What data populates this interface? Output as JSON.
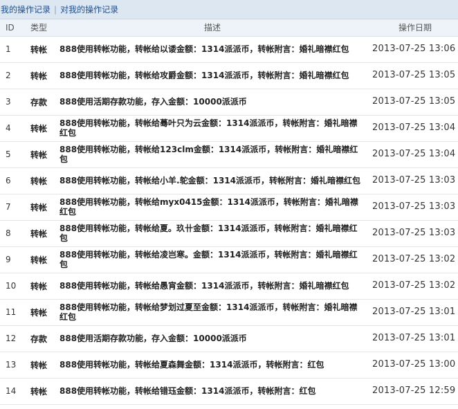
{
  "tabs": {
    "my_records": "我的操作记录",
    "separator": "|",
    "records_on_me": "对我的操作记录"
  },
  "table": {
    "headers": {
      "id": "ID",
      "type": "类型",
      "description": "描述",
      "date": "操作日期"
    },
    "rows": [
      {
        "id": "1",
        "type": "转帐",
        "description": "888使用转帐功能，转帐给以诿金额：1314派派币，转帐附言：婚礼暗襟红包",
        "date": "2013-07-25 13:06"
      },
      {
        "id": "2",
        "type": "转帐",
        "description": "888使用转帐功能，转帐给攻爵金额：1314派派币，转帐附言：婚礼暗襟红包",
        "date": "2013-07-25 13:05"
      },
      {
        "id": "3",
        "type": "存款",
        "description": "888使用活期存款功能，存入金额：10000派派币",
        "date": "2013-07-25 13:05"
      },
      {
        "id": "4",
        "type": "转帐",
        "description": "888使用转帐功能，转帐给蓦叶只为云金额：1314派派币，转帐附言：婚礼暗襟红包",
        "date": "2013-07-25 13:04"
      },
      {
        "id": "5",
        "type": "转帐",
        "description": "888使用转帐功能，转帐给123clm金额：1314派派币，转帐附言：婚礼暗襟红包",
        "date": "2013-07-25 13:04"
      },
      {
        "id": "6",
        "type": "转帐",
        "description": "888使用转帐功能，转帐给小羊.鸵金额：1314派派币，转帐附言：婚礼暗襟红包",
        "date": "2013-07-25 13:03"
      },
      {
        "id": "7",
        "type": "转帐",
        "description": "888使用转帐功能，转帐给myx0415金额：1314派派币，转帐附言：婚礼暗襟红包",
        "date": "2013-07-25 13:03"
      },
      {
        "id": "8",
        "type": "转帐",
        "description": "888使用转帐功能，转帐给夏。玖卄金额：1314派派币，转帐附言：婚礼暗襟红包",
        "date": "2013-07-25 13:03"
      },
      {
        "id": "9",
        "type": "转帐",
        "description": "888使用转帐功能，转帐给凌岂寒。金额：1314派派币，转帐附言：婚礼暗襟红包",
        "date": "2013-07-25 13:02"
      },
      {
        "id": "10",
        "type": "转帐",
        "description": "888使用转帐功能，转帐给愚宵金额：1314派派币，转帐附言：婚礼暗襟红包",
        "date": "2013-07-25 13:02"
      },
      {
        "id": "11",
        "type": "转帐",
        "description": "888使用转帐功能，转帐给梦划过夏至金额：1314派派币，转帐附言：婚礼暗襟红包",
        "date": "2013-07-25 13:01"
      },
      {
        "id": "12",
        "type": "存款",
        "description": "888使用活期存款功能，存入金额：10000派派币",
        "date": "2013-07-25 13:01"
      },
      {
        "id": "13",
        "type": "转帐",
        "description": "888使用转帐功能，转帐给夏森舞金额：1314派派币，转帐附言：红包",
        "date": "2013-07-25 13:00"
      },
      {
        "id": "14",
        "type": "转帐",
        "description": "888使用转帐功能，转帐给错珏金额：1314派派币，转帐附言：红包",
        "date": "2013-07-25 12:59"
      }
    ]
  }
}
